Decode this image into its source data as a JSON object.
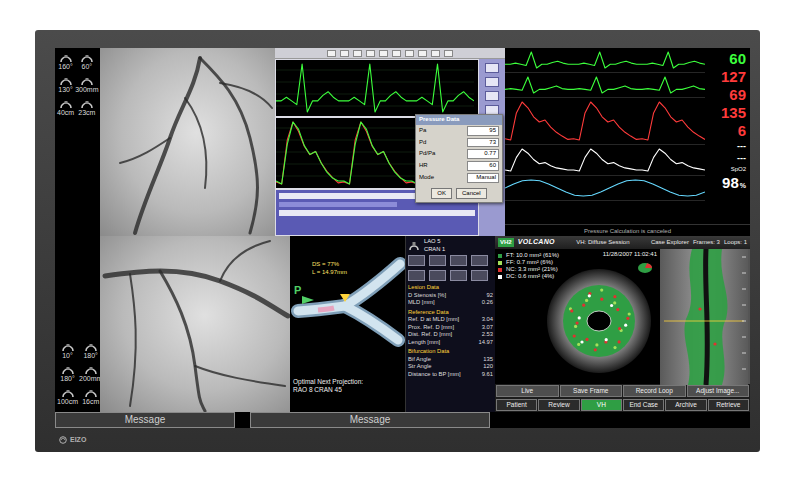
{
  "monitor": {
    "brand": "EIZO"
  },
  "geometry": {
    "groups": [
      {
        "items": [
          {
            "value": "160°"
          },
          {
            "value": "60°"
          },
          {
            "value": "130°"
          },
          {
            "value": "300mm"
          },
          {
            "value": "40cm"
          },
          {
            "value": "23cm"
          }
        ]
      },
      {
        "items": [
          {
            "value": "10°"
          },
          {
            "value": "180°"
          },
          {
            "value": "180°"
          },
          {
            "value": "200mm"
          },
          {
            "value": "100cm"
          },
          {
            "value": "16cm"
          }
        ]
      }
    ]
  },
  "hemo": {
    "panels": [
      {
        "traces": [
          {
            "color": "#3cff3c",
            "values": [
              0,
              0,
              0.1,
              0,
              -0.1,
              1,
              -0.3,
              0,
              0,
              0.15,
              0.25,
              0.1,
              0,
              0,
              0,
              0.1,
              0,
              -0.1,
              1,
              -0.3,
              0,
              0,
              0.15,
              0.25,
              0.1,
              0,
              0,
              0,
              0.1,
              0,
              -0.1,
              1,
              -0.3,
              0,
              0,
              0.15,
              0.25,
              0.1,
              0
            ]
          }
        ]
      },
      {
        "traces": [
          {
            "color": "#ff3b3b",
            "values": [
              70,
              68,
              110,
              127,
              118,
              104,
              96,
              99,
              88,
              80,
              74,
              69,
              70,
              68,
              110,
              127,
              118,
              104,
              96,
              99,
              88,
              80,
              74,
              69,
              70,
              68,
              110,
              127,
              118,
              104,
              96,
              99,
              88,
              80,
              74,
              69
            ]
          },
          {
            "color": "#3cff3c",
            "values": [
              60,
              58,
              85,
              100,
              95,
              84,
              78,
              80,
              72,
              66,
              62,
              60,
              60,
              58,
              85,
              100,
              95,
              84,
              78,
              80,
              72,
              66,
              62,
              60,
              60,
              58,
              85,
              100,
              95,
              84,
              78,
              80,
              72,
              66,
              62,
              60
            ]
          }
        ]
      }
    ],
    "dialog": {
      "title": "Pressure Data",
      "rows": [
        {
          "label": "Pa",
          "value": "95"
        },
        {
          "label": "Pd",
          "value": "73"
        },
        {
          "label": "Pd/Pa",
          "value": "0.77"
        },
        {
          "label": "HR",
          "value": "60"
        },
        {
          "label": "Mode",
          "value": "Manual"
        }
      ],
      "buttons": [
        "OK",
        "Cancel"
      ]
    }
  },
  "vitals": {
    "traces": [
      {
        "color": "#3cff3c",
        "values": [
          0,
          0,
          0.1,
          0,
          -0.1,
          1,
          -0.3,
          0,
          0,
          0.15,
          0.25,
          0.1,
          0,
          0,
          0,
          0.1,
          0,
          -0.1,
          1,
          -0.3,
          0,
          0,
          0.15,
          0.25,
          0.1,
          0,
          0,
          0,
          0.1,
          0,
          -0.1,
          1,
          -0.3,
          0,
          0,
          0.15,
          0.25,
          0.1,
          0
        ]
      },
      {
        "color": "#3cff3c",
        "values": [
          0,
          0.05,
          0,
          -0.05,
          0.7,
          -0.2,
          0,
          0,
          0.1,
          0.2,
          0.05,
          0,
          0,
          0.05,
          0,
          -0.05,
          0.7,
          -0.2,
          0,
          0,
          0.1,
          0.2,
          0.05,
          0,
          0,
          0.05,
          0,
          -0.05,
          0.7,
          -0.2,
          0,
          0,
          0.1,
          0.2,
          0.05,
          0
        ]
      },
      {
        "color": "#ff3b3b",
        "values": [
          70,
          68,
          110,
          127,
          118,
          104,
          96,
          99,
          88,
          80,
          74,
          69,
          70,
          68,
          110,
          127,
          118,
          104,
          96,
          99,
          88,
          80,
          74,
          69,
          70,
          68,
          110,
          127,
          118,
          104,
          96,
          99,
          88,
          80,
          74,
          69
        ]
      },
      {
        "color": "#ffffff",
        "values": [
          10,
          9,
          22,
          30,
          26,
          20,
          16,
          17,
          14,
          12,
          11,
          10,
          10,
          9,
          22,
          30,
          26,
          20,
          16,
          17,
          14,
          12,
          11,
          10,
          10,
          9,
          22,
          30,
          26,
          20,
          16,
          17,
          14,
          12,
          11,
          10
        ]
      },
      {
        "color": "#66d9ff",
        "values": [
          0,
          0.5,
          0.9,
          1,
          0.9,
          0.5,
          0,
          -0.5,
          -0.9,
          -1,
          -0.9,
          -0.5,
          0,
          0.5,
          0.9,
          1,
          0.9,
          0.5,
          0,
          -0.5,
          -0.9,
          -1,
          -0.9,
          -0.5
        ]
      }
    ],
    "readings": [
      {
        "text": "60",
        "color": "#3cff3c",
        "kind": "value"
      },
      {
        "text": "127",
        "color": "#ff3b3b",
        "kind": "value"
      },
      {
        "text": "69",
        "color": "#ff3b3b",
        "kind": "value"
      },
      {
        "text": "135",
        "color": "#ff3b3b",
        "kind": "value"
      },
      {
        "text": "6",
        "color": "#ff3b3b",
        "kind": "value"
      },
      {
        "text": "---",
        "color": "#ffffff",
        "kind": "dash"
      },
      {
        "text": "---",
        "color": "#ffffff",
        "kind": "dash"
      },
      {
        "text": "SpO2",
        "color": "#ffffff",
        "kind": "label"
      },
      {
        "text": "98",
        "unit": "%",
        "color": "#ffffff",
        "kind": "value"
      }
    ],
    "status": "Pressure Calculation is canceled"
  },
  "qca": {
    "view": [
      "LAO 5",
      "CRAN 1"
    ],
    "markers": {
      "proximal": "P"
    },
    "measure": [
      "DS = 77%",
      "L = 14.97mm"
    ],
    "projection": {
      "label": "Optimal Next Projection:",
      "value": "RAO 8  CRAN 45"
    },
    "sections": [
      {
        "title": "Lesion Data",
        "rows": [
          {
            "label": "D Stenosis [%]",
            "value": "92"
          },
          {
            "label": "MLD [mm]",
            "value": "0.26"
          }
        ]
      },
      {
        "title": "Reference Data",
        "rows": [
          {
            "label": "Ref. D at MLD [mm]",
            "value": "3.04"
          },
          {
            "label": "Prox. Ref. D [mm]",
            "value": "3.07"
          },
          {
            "label": "Dist. Ref. D [mm]",
            "value": "2.53"
          },
          {
            "label": "Length [mm]",
            "value": "14.97"
          }
        ]
      },
      {
        "title": "Bifurcation Data",
        "rows": [
          {
            "label": "Bif Angle",
            "value": "135"
          },
          {
            "label": "Str Angle",
            "value": "120"
          },
          {
            "label": "Distance to BP [mm]",
            "value": "9.61"
          }
        ]
      }
    ]
  },
  "ivus": {
    "mode": "VH2",
    "brand": "VOLCANO",
    "session": "VH: Diffuse Session",
    "timestamp": "11/28/2007 11:02:41",
    "explorer": [
      "Case Explorer",
      "Frames: 3",
      "Loops: 1"
    ],
    "legend": [
      {
        "text": "FT: 10.0 mm² (61%)",
        "color": "#2f9e44"
      },
      {
        "text": "FF: 0.7 mm² (6%)",
        "color": "#a3e05a"
      },
      {
        "text": "NC: 3.3 mm² (21%)",
        "color": "#e03131"
      },
      {
        "text": "DC: 0.6 mm² (4%)",
        "color": "#ffffff"
      }
    ],
    "actions": [
      "Live",
      "Save Frame",
      "Record Loop",
      "Adjust Image..."
    ],
    "tabs": [
      {
        "label": "Patient",
        "selected": false
      },
      {
        "label": "Review",
        "selected": false
      },
      {
        "label": "VH",
        "selected": true
      },
      {
        "label": "End Case",
        "selected": false
      },
      {
        "label": "Archive",
        "selected": false
      },
      {
        "label": "Retrieve",
        "selected": false
      }
    ]
  },
  "messages": [
    "Message",
    "Message"
  ]
}
